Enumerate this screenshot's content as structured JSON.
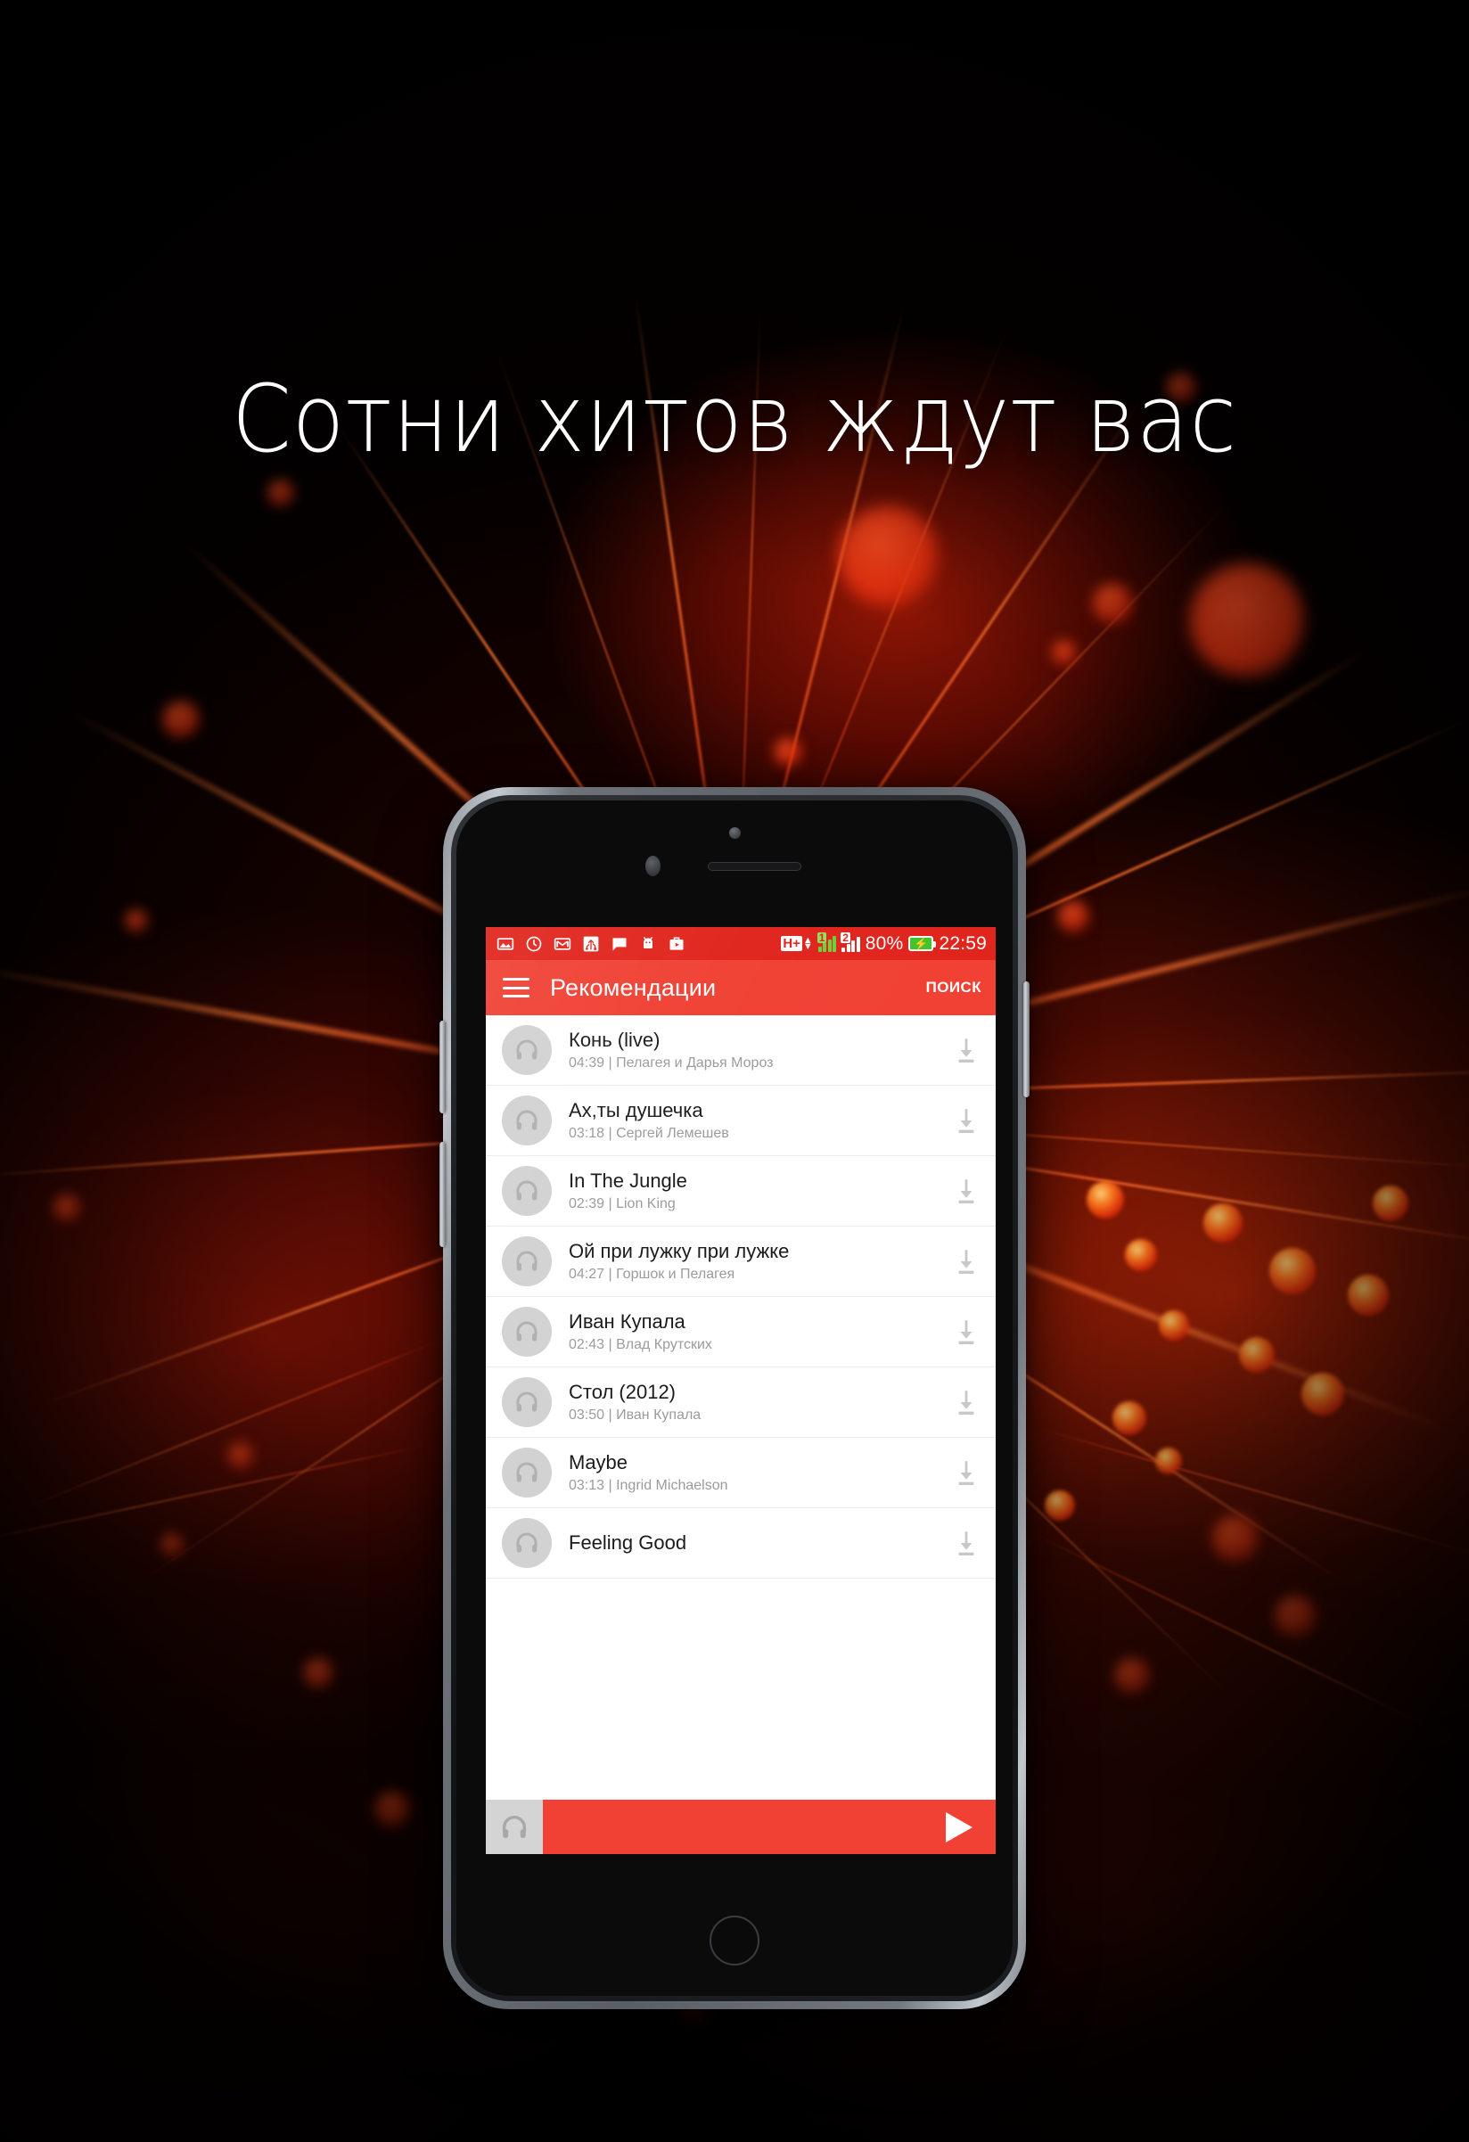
{
  "promo": {
    "headline": "Сотни хитов ждут вас"
  },
  "status_bar": {
    "icons": [
      "photo-icon",
      "clock-icon",
      "gmail-icon",
      "usb-icon",
      "chat-icon",
      "android-icon",
      "play-store-icon"
    ],
    "network_type": "H+",
    "sim1_label": "1",
    "sim2_label": "2",
    "battery_percent": "80%",
    "battery_state": "charging",
    "clock": "22:59"
  },
  "app_bar": {
    "menu_icon": "hamburger-menu-icon",
    "title": "Рекомендации",
    "action_label": "ПОИСК"
  },
  "tracks": [
    {
      "title": "Конь (live)",
      "duration": "04:39",
      "artist": "Пелагея и Дарья Мороз",
      "meta": "04:39 | Пелагея и Дарья Мороз"
    },
    {
      "title": "Ах,ты душечка",
      "duration": "03:18",
      "artist": "Сергей Лемешев",
      "meta": "03:18 | Сергей Лемешев"
    },
    {
      "title": "In The Jungle",
      "duration": "02:39",
      "artist": "Lion King",
      "meta": "02:39 | Lion King"
    },
    {
      "title": "Ой при лужку при лужке",
      "duration": "04:27",
      "artist": "Горшок и Пелагея",
      "meta": "04:27 | Горшок и Пелагея"
    },
    {
      "title": "Иван Купала",
      "duration": "02:43",
      "artist": "Влад Крутских",
      "meta": "02:43 | Влад Крутских"
    },
    {
      "title": "Стол (2012)",
      "duration": "03:50",
      "artist": "Иван Купала",
      "meta": "03:50 | Иван Купала"
    },
    {
      "title": "Maybe",
      "duration": "03:13",
      "artist": "Ingrid Michaelson",
      "meta": "03:13 | Ingrid Michaelson"
    },
    {
      "title": "Feeling Good",
      "duration": "",
      "artist": "",
      "meta": ""
    }
  ],
  "player": {
    "thumb_icon": "headphones-icon",
    "play_icon": "play-icon"
  },
  "colors": {
    "accent_red": "#f04134",
    "status_red": "#e0251d",
    "avatar_gray": "#d2d2d2",
    "subtitle_gray": "#9b9b9b",
    "download_gray": "#c8c8c8",
    "battery_green": "#3fc52e"
  }
}
